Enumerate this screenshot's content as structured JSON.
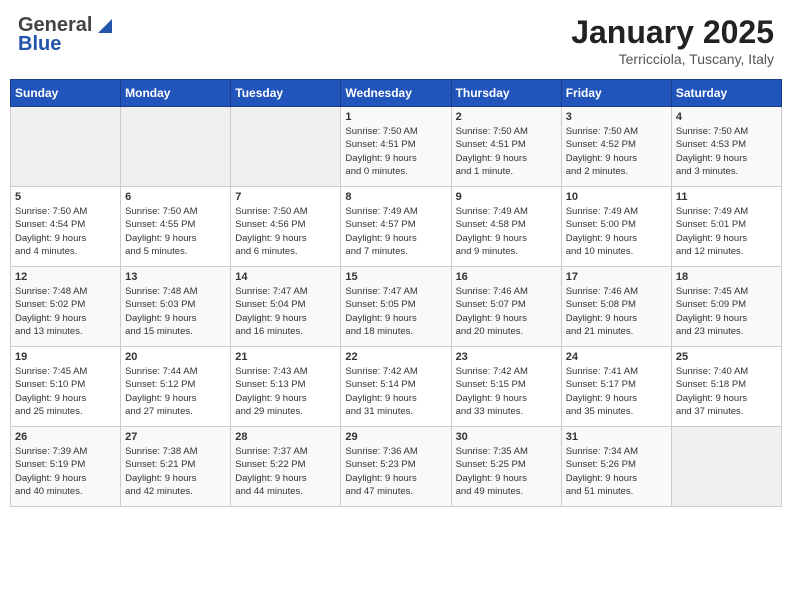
{
  "header": {
    "logo_general": "General",
    "logo_blue": "Blue",
    "title": "January 2025",
    "subtitle": "Terricciola, Tuscany, Italy"
  },
  "columns": [
    "Sunday",
    "Monday",
    "Tuesday",
    "Wednesday",
    "Thursday",
    "Friday",
    "Saturday"
  ],
  "weeks": [
    {
      "days": [
        {
          "number": "",
          "info": "",
          "empty": true
        },
        {
          "number": "",
          "info": "",
          "empty": true
        },
        {
          "number": "",
          "info": "",
          "empty": true
        },
        {
          "number": "1",
          "info": "Sunrise: 7:50 AM\nSunset: 4:51 PM\nDaylight: 9 hours\nand 0 minutes."
        },
        {
          "number": "2",
          "info": "Sunrise: 7:50 AM\nSunset: 4:51 PM\nDaylight: 9 hours\nand 1 minute."
        },
        {
          "number": "3",
          "info": "Sunrise: 7:50 AM\nSunset: 4:52 PM\nDaylight: 9 hours\nand 2 minutes."
        },
        {
          "number": "4",
          "info": "Sunrise: 7:50 AM\nSunset: 4:53 PM\nDaylight: 9 hours\nand 3 minutes."
        }
      ]
    },
    {
      "days": [
        {
          "number": "5",
          "info": "Sunrise: 7:50 AM\nSunset: 4:54 PM\nDaylight: 9 hours\nand 4 minutes."
        },
        {
          "number": "6",
          "info": "Sunrise: 7:50 AM\nSunset: 4:55 PM\nDaylight: 9 hours\nand 5 minutes."
        },
        {
          "number": "7",
          "info": "Sunrise: 7:50 AM\nSunset: 4:56 PM\nDaylight: 9 hours\nand 6 minutes."
        },
        {
          "number": "8",
          "info": "Sunrise: 7:49 AM\nSunset: 4:57 PM\nDaylight: 9 hours\nand 7 minutes."
        },
        {
          "number": "9",
          "info": "Sunrise: 7:49 AM\nSunset: 4:58 PM\nDaylight: 9 hours\nand 9 minutes."
        },
        {
          "number": "10",
          "info": "Sunrise: 7:49 AM\nSunset: 5:00 PM\nDaylight: 9 hours\nand 10 minutes."
        },
        {
          "number": "11",
          "info": "Sunrise: 7:49 AM\nSunset: 5:01 PM\nDaylight: 9 hours\nand 12 minutes."
        }
      ]
    },
    {
      "days": [
        {
          "number": "12",
          "info": "Sunrise: 7:48 AM\nSunset: 5:02 PM\nDaylight: 9 hours\nand 13 minutes."
        },
        {
          "number": "13",
          "info": "Sunrise: 7:48 AM\nSunset: 5:03 PM\nDaylight: 9 hours\nand 15 minutes."
        },
        {
          "number": "14",
          "info": "Sunrise: 7:47 AM\nSunset: 5:04 PM\nDaylight: 9 hours\nand 16 minutes."
        },
        {
          "number": "15",
          "info": "Sunrise: 7:47 AM\nSunset: 5:05 PM\nDaylight: 9 hours\nand 18 minutes."
        },
        {
          "number": "16",
          "info": "Sunrise: 7:46 AM\nSunset: 5:07 PM\nDaylight: 9 hours\nand 20 minutes."
        },
        {
          "number": "17",
          "info": "Sunrise: 7:46 AM\nSunset: 5:08 PM\nDaylight: 9 hours\nand 21 minutes."
        },
        {
          "number": "18",
          "info": "Sunrise: 7:45 AM\nSunset: 5:09 PM\nDaylight: 9 hours\nand 23 minutes."
        }
      ]
    },
    {
      "days": [
        {
          "number": "19",
          "info": "Sunrise: 7:45 AM\nSunset: 5:10 PM\nDaylight: 9 hours\nand 25 minutes."
        },
        {
          "number": "20",
          "info": "Sunrise: 7:44 AM\nSunset: 5:12 PM\nDaylight: 9 hours\nand 27 minutes."
        },
        {
          "number": "21",
          "info": "Sunrise: 7:43 AM\nSunset: 5:13 PM\nDaylight: 9 hours\nand 29 minutes."
        },
        {
          "number": "22",
          "info": "Sunrise: 7:42 AM\nSunset: 5:14 PM\nDaylight: 9 hours\nand 31 minutes."
        },
        {
          "number": "23",
          "info": "Sunrise: 7:42 AM\nSunset: 5:15 PM\nDaylight: 9 hours\nand 33 minutes."
        },
        {
          "number": "24",
          "info": "Sunrise: 7:41 AM\nSunset: 5:17 PM\nDaylight: 9 hours\nand 35 minutes."
        },
        {
          "number": "25",
          "info": "Sunrise: 7:40 AM\nSunset: 5:18 PM\nDaylight: 9 hours\nand 37 minutes."
        }
      ]
    },
    {
      "days": [
        {
          "number": "26",
          "info": "Sunrise: 7:39 AM\nSunset: 5:19 PM\nDaylight: 9 hours\nand 40 minutes."
        },
        {
          "number": "27",
          "info": "Sunrise: 7:38 AM\nSunset: 5:21 PM\nDaylight: 9 hours\nand 42 minutes."
        },
        {
          "number": "28",
          "info": "Sunrise: 7:37 AM\nSunset: 5:22 PM\nDaylight: 9 hours\nand 44 minutes."
        },
        {
          "number": "29",
          "info": "Sunrise: 7:36 AM\nSunset: 5:23 PM\nDaylight: 9 hours\nand 47 minutes."
        },
        {
          "number": "30",
          "info": "Sunrise: 7:35 AM\nSunset: 5:25 PM\nDaylight: 9 hours\nand 49 minutes."
        },
        {
          "number": "31",
          "info": "Sunrise: 7:34 AM\nSunset: 5:26 PM\nDaylight: 9 hours\nand 51 minutes."
        },
        {
          "number": "",
          "info": "",
          "empty": true
        }
      ]
    }
  ]
}
